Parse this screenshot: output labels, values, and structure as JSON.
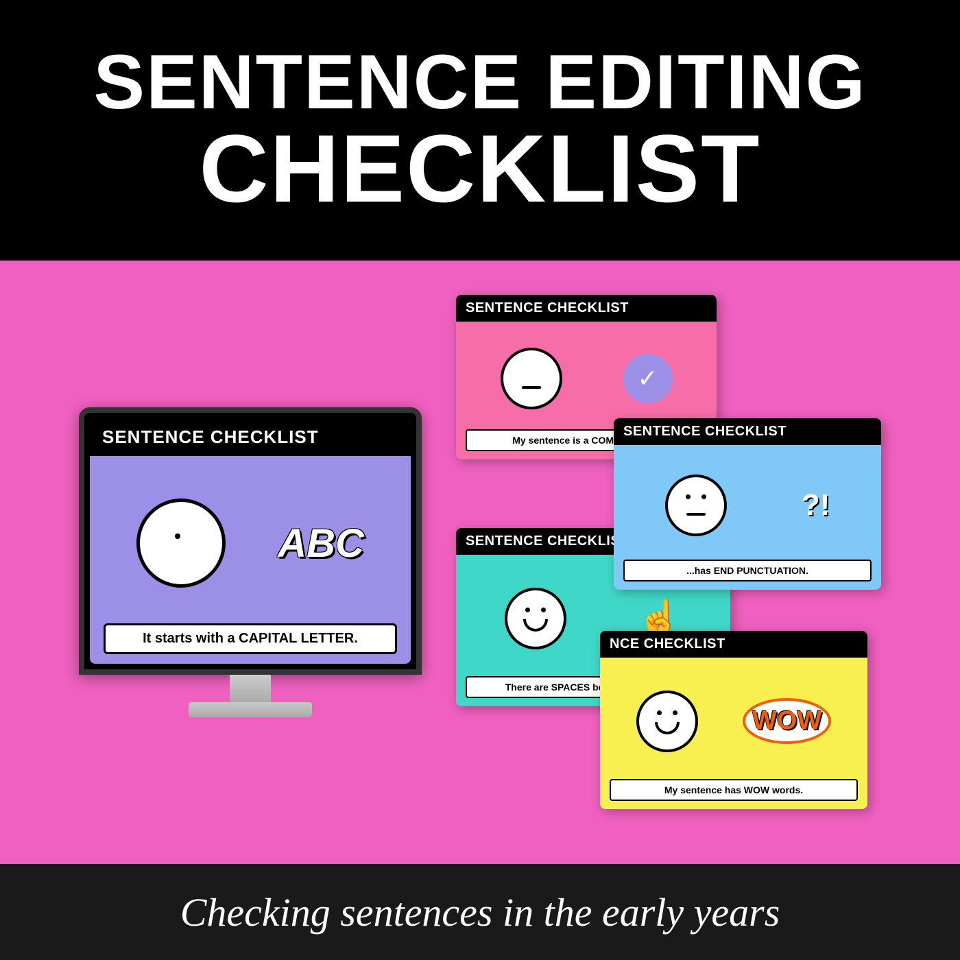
{
  "header": {
    "line1": "SENTENCE EDITING",
    "line2": "CHECKLIST"
  },
  "monitor": {
    "header": "SENTENCE CHECKLIST",
    "abc_label": "ABC",
    "caption": "It starts with a CAPITAL LETTER."
  },
  "card1": {
    "header": "SENTENCE CHECKLIST",
    "caption": "My sentence is a COMPLETE T..."
  },
  "card2": {
    "header": "SENTENCE CHECKLIST",
    "caption": "...has END PUNCTUATION."
  },
  "card3": {
    "header": "SENTENCE CHECKLIST",
    "caption": "There are SPACES between my words."
  },
  "card4": {
    "header": "NCE CHECKLIST",
    "caption": "My sentence has WOW words."
  },
  "footer": {
    "text": "Checking sentences in the early years"
  }
}
